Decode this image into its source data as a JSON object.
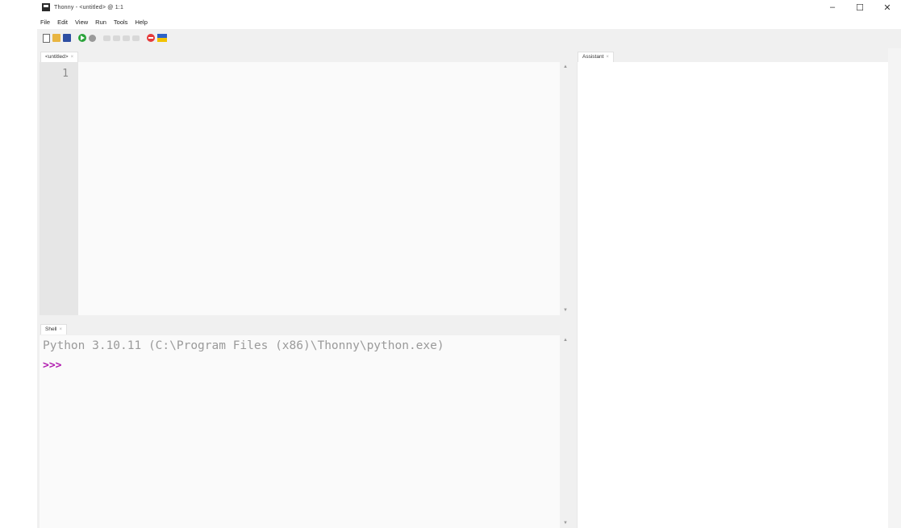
{
  "window": {
    "title": "Thonny - <untitled> @ 1:1",
    "controls": [
      "–",
      "☐",
      "✕"
    ]
  },
  "menu": [
    "File",
    "Edit",
    "View",
    "Run",
    "Tools",
    "Help"
  ],
  "toolbar": {
    "icons": [
      "new-file-icon",
      "open-file-icon",
      "save-icon",
      "run-icon",
      "debug-icon",
      "step-over-icon",
      "step-into-icon",
      "step-out-icon",
      "resume-icon",
      "stop-icon",
      "ukraine-flag-icon"
    ]
  },
  "editor": {
    "tab_label": "<untitled>",
    "tab_close": "×",
    "line_numbers": [
      "1"
    ]
  },
  "shell": {
    "tab_label": "Shell",
    "tab_close": "×",
    "banner": "Python 3.10.11 (C:\\Program Files (x86)\\Thonny\\python.exe)",
    "prompt": ">>>"
  },
  "assistant": {
    "tab_label": "Assistant",
    "tab_close": "×"
  },
  "scroll": {
    "up": "▲",
    "down": "▼"
  }
}
